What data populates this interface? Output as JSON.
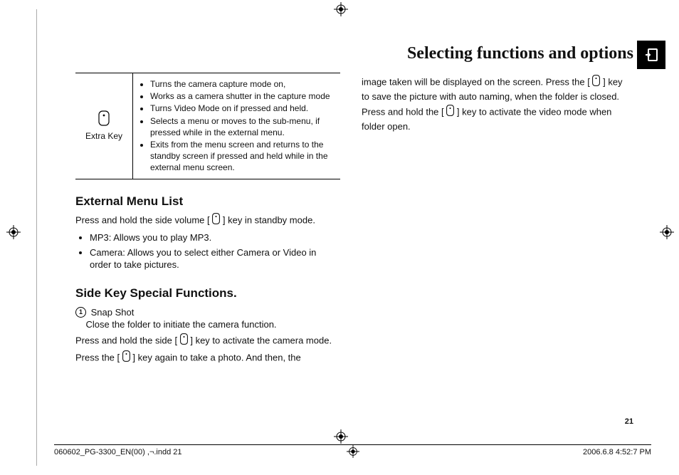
{
  "header": {
    "title": "Selecting functions and options"
  },
  "table": {
    "key_label": "Extra Key",
    "bullets": [
      "Turns the camera capture mode on,",
      "Works as a camera shutter in the capture mode",
      "Turns Video Mode on if pressed and held.",
      "Selects a menu or moves to the sub-menu, if pressed while in the external menu.",
      "Exits from the menu screen and returns to the standby screen if pressed and held while in the external menu screen."
    ]
  },
  "section1": {
    "heading": "External Menu List",
    "intro_before": "Press and hold the side volume [",
    "intro_after": "] key in standby mode.",
    "items": [
      "MP3: Allows you to play MP3.",
      "Camera: Allows you to select either Camera or Video in order to take pictures."
    ]
  },
  "section2": {
    "heading": "Side Key Special Functions.",
    "snap_num": "1",
    "snap_title": "Snap Shot",
    "snap_sub": "Close the folder to initiate the camera function.",
    "p1_before": "Press and hold the side [",
    "p1_after": "] key to activate the camera mode.",
    "p2_before": "Press the [",
    "p2_after": "] key again to take a photo. And then, the"
  },
  "col2": {
    "p1_before": "image taken will be displayed on the screen. Press the [",
    "p1_after": "] key to save the picture with auto naming, when the folder is closed.",
    "p2_before": "Press and hold the [",
    "p2_after": "] key to activate the video mode when folder open."
  },
  "pageNumber": "21",
  "footer": {
    "left": "060602_PG-3300_EN(00) ,¬.indd   21",
    "right": "2006.6.8   4:52:7 PM"
  }
}
